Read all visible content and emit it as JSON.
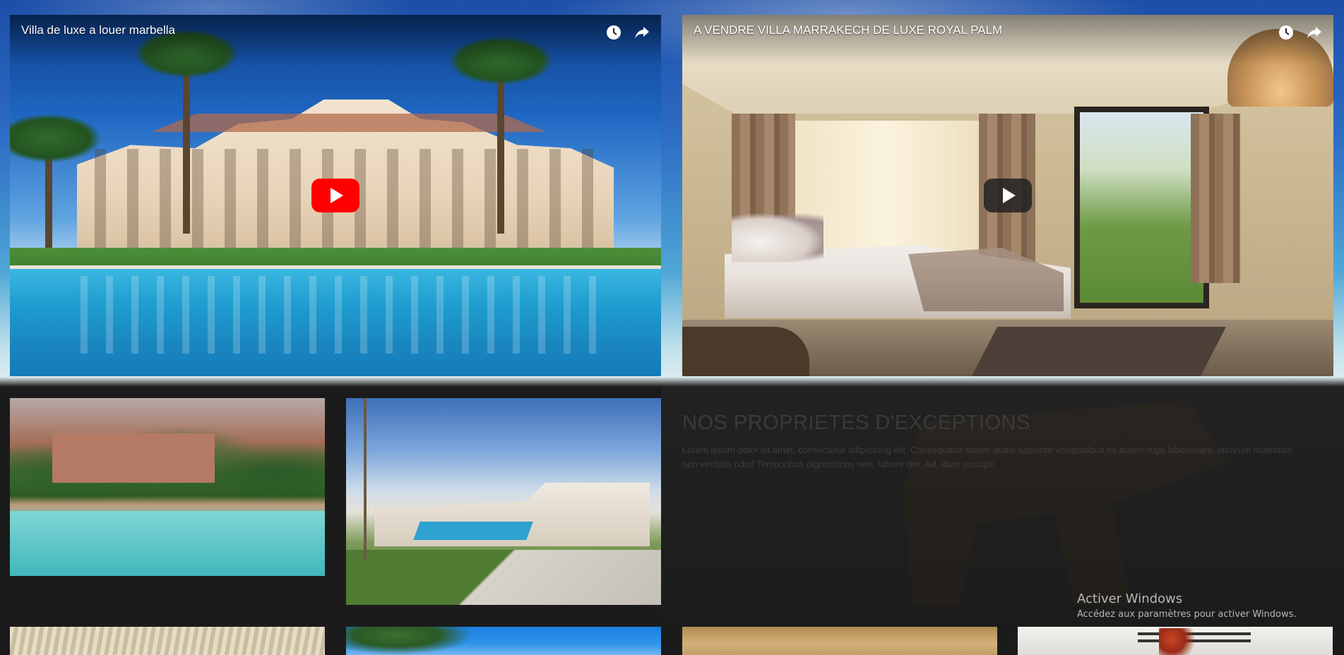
{
  "videos": [
    {
      "title": "Villa de luxe a louer marbella",
      "play_button_style": "red",
      "icons": [
        "clock-icon",
        "share-icon"
      ]
    },
    {
      "title": "A VENDRE VILLA MARRAKECH DE LUXE ROYAL PALM",
      "play_button_style": "dark",
      "icons": [
        "clock-icon",
        "share-icon"
      ]
    }
  ],
  "section": {
    "title": "NOS PROPRIETES D'EXCEPTIONS",
    "text": "Lorem ipsum dolor sit amet, consectetur adipisicing elit. Consequatur labore quasi sapiente voluptatibus ex autem fuga laboriosam, laborum molestias non veritatis odio! Temporibus dignissimos rem, labore iste. Ad, illum suscipit."
  },
  "windows_activation": {
    "title": "Activer Windows",
    "subtitle": "Accédez aux paramètres pour activer Windows."
  },
  "colors": {
    "play_red": "#ff0000",
    "page_background": "#1b1b1b",
    "section_title": "#3a3a3a",
    "watermark_text": "#b8b8b8"
  }
}
